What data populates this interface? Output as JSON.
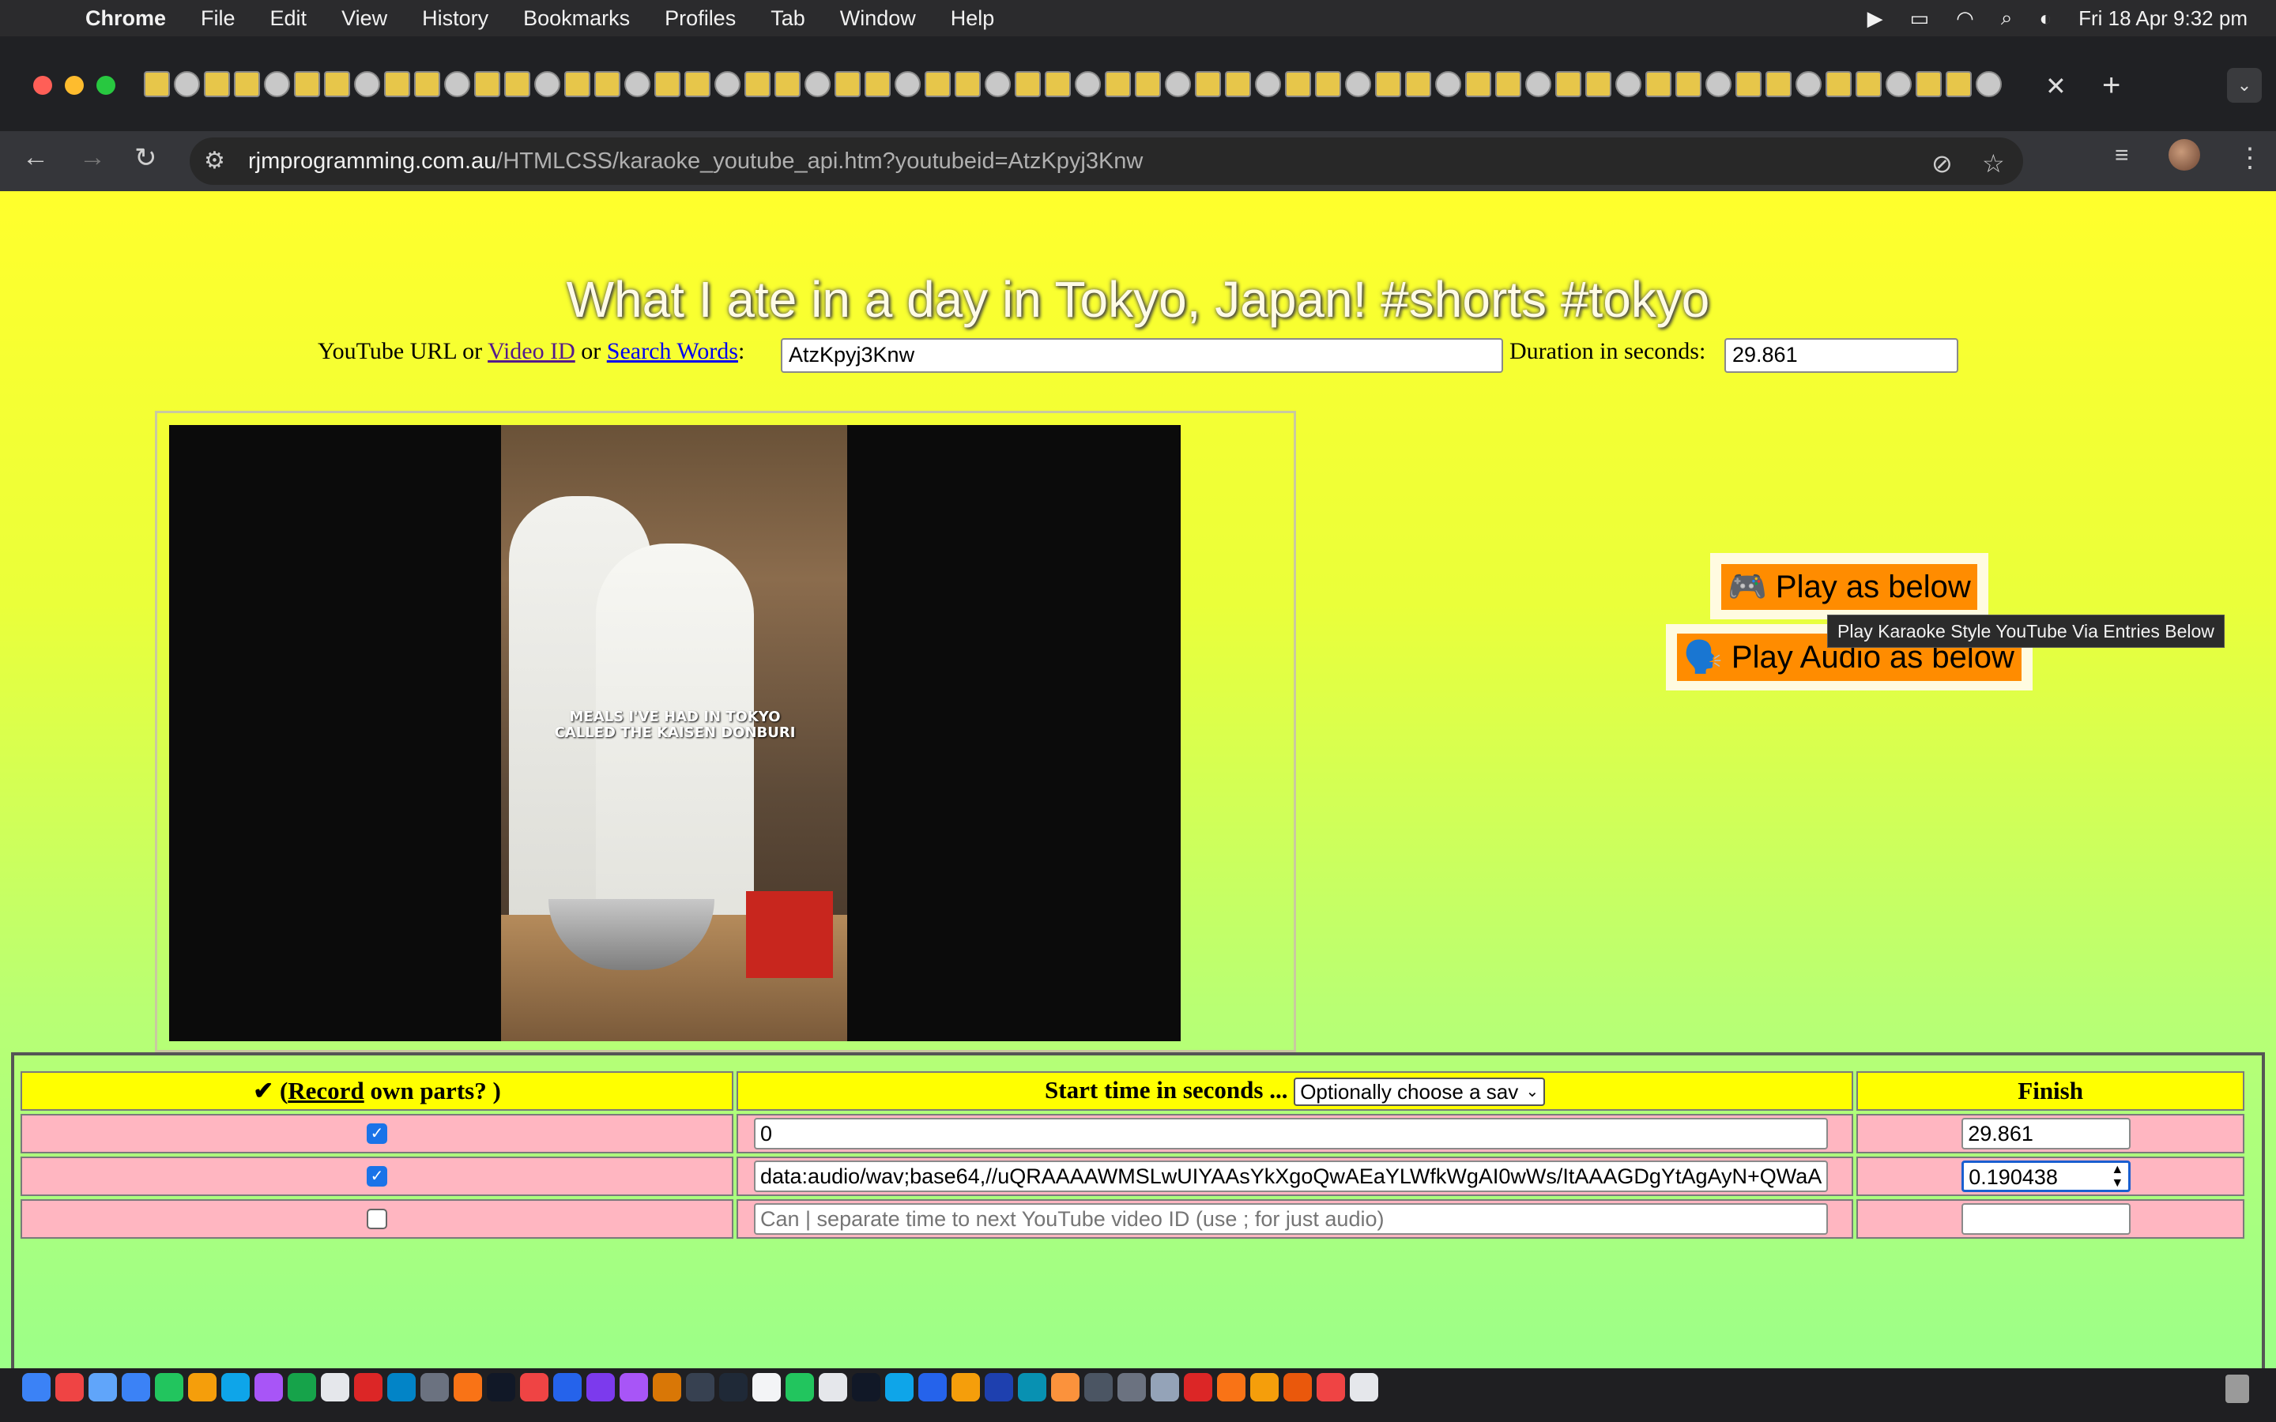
{
  "menubar": {
    "app": "Chrome",
    "items": [
      "File",
      "Edit",
      "View",
      "History",
      "Bookmarks",
      "Profiles",
      "Tab",
      "Window",
      "Help"
    ],
    "clock": "Fri 18 Apr  9:32 pm"
  },
  "browser": {
    "url_host": "rjmprogramming.com.au",
    "url_path": "/HTMLCSS/karaoke_youtube_api.htm?youtubeid=AtzKpyj3Knw",
    "tab_count_visible": 62
  },
  "page": {
    "title": "What I ate in a day in Tokyo, Japan! #shorts #tokyo",
    "url_label_prefix": "YouTube URL or ",
    "video_id_link": "Video ID",
    "or_text": " or ",
    "search_words_link": "Search Words",
    "colon": ":",
    "video_id_value": "AtzKpyj3Knw",
    "duration_label": "Duration in seconds:",
    "duration_value": "29.861",
    "video_caption": "MEALS I'VE HAD IN TOKYO CALLED THE KAISEN DONBURI",
    "play_button": "🎮 Play as below",
    "play_audio_button": "🗣️ Play Audio as below",
    "tooltip": "Play Karaoke Style YouTube Via Entries Below"
  },
  "table": {
    "header_record_prefix": "✔ (",
    "header_record_link": "Record",
    "header_record_suffix": " own parts?      )",
    "header_start": "Start time in seconds ... ",
    "header_select": "Optionally choose a sav",
    "header_finish": "Finish",
    "rows": [
      {
        "checked": true,
        "start": "0",
        "finish": "29.861"
      },
      {
        "checked": true,
        "start": "data:audio/wav;base64,//uQRAAAAWMSLwUIYAAsYkXgoQwAEaYLWfkWgAI0wWs/ItAAAGDgYtAgAyN+QWaA",
        "finish": "0.190438"
      },
      {
        "checked": false,
        "start": "",
        "start_placeholder": "Can | separate time to next YouTube video ID (use ; for just audio)",
        "finish": ""
      }
    ]
  }
}
